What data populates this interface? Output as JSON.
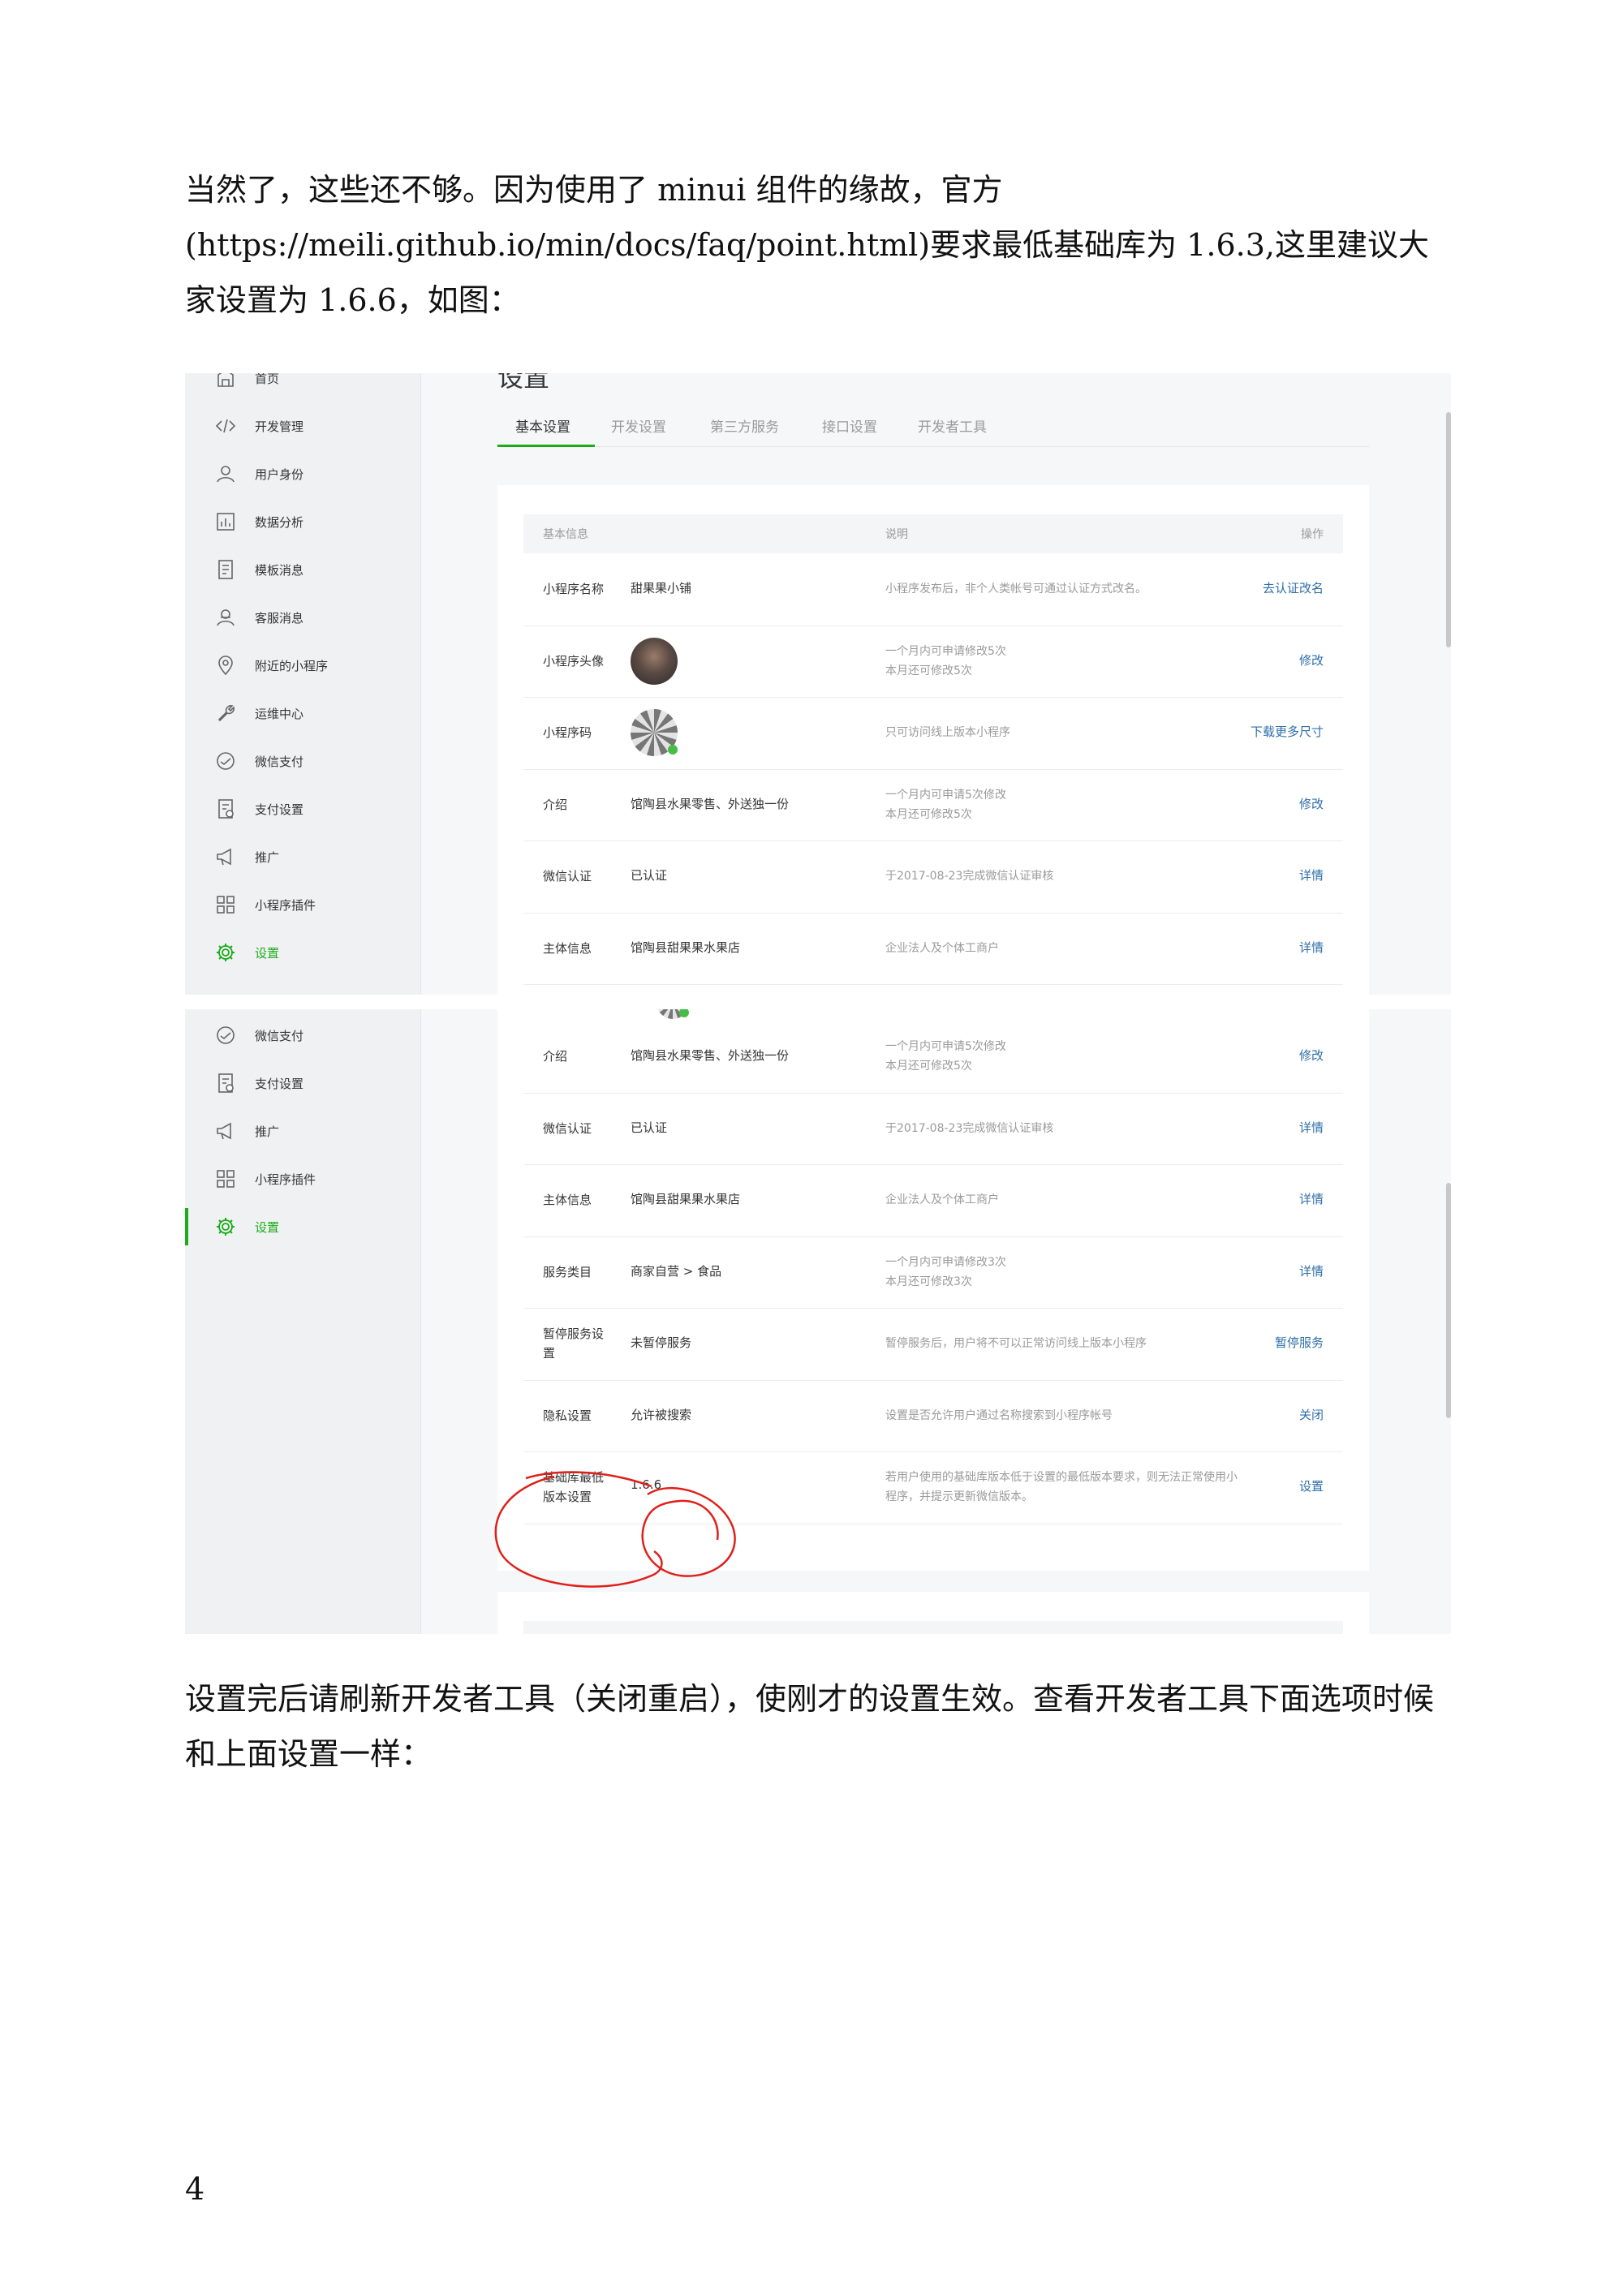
{
  "document": {
    "para1": "当然了，这些还不够。因为使用了 minui 组件的缘故，官方 (https://meili.github.io/min/docs/faq/point.html)要求最低基础库为 1.6.3,这里建议大家设置为 1.6.6，如图：",
    "para2": "设置完后请刷新开发者工具（关闭重启），使刚才的设置生效。查看开发者工具下面选项时候和上面设置一样：",
    "page_number": "4"
  },
  "shot1": {
    "page_title": "设置",
    "tabs": [
      "基本设置",
      "开发设置",
      "第三方服务",
      "接口设置",
      "开发者工具"
    ],
    "nav": [
      {
        "label": "首页",
        "icon": "home-icon"
      },
      {
        "label": "开发管理",
        "icon": "code-icon"
      },
      {
        "label": "用户身份",
        "icon": "user-icon"
      },
      {
        "label": "数据分析",
        "icon": "chart-icon"
      },
      {
        "label": "模板消息",
        "icon": "template-icon"
      },
      {
        "label": "客服消息",
        "icon": "service-icon"
      },
      {
        "label": "附近的小程序",
        "icon": "location-icon"
      },
      {
        "label": "运维中心",
        "icon": "wrench-icon"
      },
      {
        "label": "微信支付",
        "icon": "pay-icon"
      },
      {
        "label": "支付设置",
        "icon": "pay-settings-icon"
      },
      {
        "label": "推广",
        "icon": "megaphone-icon"
      },
      {
        "label": "小程序插件",
        "icon": "plugin-icon"
      },
      {
        "label": "设置",
        "icon": "gear-icon",
        "active": true
      }
    ],
    "table_headers": [
      "基本信息",
      "说明",
      "操作"
    ],
    "rows": [
      {
        "label": "小程序名称",
        "value": "甜果果小铺",
        "desc": "小程序发布后，非个人类帐号可通过认证方式改名。",
        "action": "去认证改名"
      },
      {
        "label": "小程序头像",
        "value": "",
        "media": "avatar",
        "desc": "一个月内可申请修改5次\n本月还可修改5次",
        "action": "修改"
      },
      {
        "label": "小程序码",
        "value": "",
        "media": "qr",
        "desc": "只可访问线上版本小程序",
        "action": "下载更多尺寸"
      },
      {
        "label": "介绍",
        "value": "馆陶县水果零售、外送独一份",
        "desc": "一个月内可申请5次修改\n本月还可修改5次",
        "action": "修改"
      },
      {
        "label": "微信认证",
        "value": "已认证",
        "desc": "于2017-08-23完成微信认证审核",
        "action": "详情"
      },
      {
        "label": "主体信息",
        "value": "馆陶县甜果果水果店",
        "desc": "企业法人及个体工商户",
        "action": "详情"
      }
    ]
  },
  "shot2": {
    "nav": [
      {
        "label": "微信支付",
        "icon": "pay-icon"
      },
      {
        "label": "支付设置",
        "icon": "pay-settings-icon"
      },
      {
        "label": "推广",
        "icon": "megaphone-icon"
      },
      {
        "label": "小程序插件",
        "icon": "plugin-icon"
      },
      {
        "label": "设置",
        "icon": "gear-icon",
        "active": true
      }
    ],
    "rows": [
      {
        "label": "介绍",
        "value": "馆陶县水果零售、外送独一份",
        "desc": "一个月内可申请5次修改\n本月还可修改5次",
        "action": "修改"
      },
      {
        "label": "微信认证",
        "value": "已认证",
        "desc": "于2017-08-23完成微信认证审核",
        "action": "详情"
      },
      {
        "label": "主体信息",
        "value": "馆陶县甜果果水果店",
        "desc": "企业法人及个体工商户",
        "action": "详情"
      },
      {
        "label": "服务类目",
        "value": "商家自营 > 食品",
        "desc": "一个月内可申请修改3次\n本月还可修改3次",
        "action": "详情"
      },
      {
        "label": "暂停服务设置",
        "value": "未暂停服务",
        "desc": "暂停服务后，用户将不可以正常访问线上版本小程序",
        "action": "暂停服务"
      },
      {
        "label": "隐私设置",
        "value": "允许被搜索",
        "desc": "设置是否允许用户通过名称搜索到小程序帐号",
        "action": "关闭"
      },
      {
        "label": "基础库最低版本设置",
        "value": "1.6.6",
        "desc": "若用户使用的基础库版本低于设置的最低版本要求，则无法正常使用小程序，并提示更新微信版本。",
        "action": "设置"
      }
    ]
  },
  "colors": {
    "accent": "#1aad19",
    "link": "#2e6ea8",
    "annotation": "#e0201b"
  }
}
